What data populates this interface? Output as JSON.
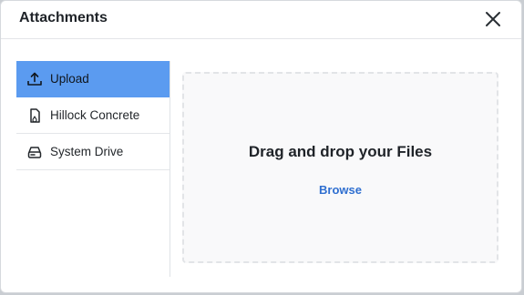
{
  "dialog": {
    "title": "Attachments",
    "close_icon": "close-icon"
  },
  "sidebar": {
    "items": [
      {
        "label": "Upload",
        "icon": "upload-icon",
        "active": true
      },
      {
        "label": "Hillock Concrete",
        "icon": "document-icon",
        "active": false
      },
      {
        "label": "System Drive",
        "icon": "drive-icon",
        "active": false
      }
    ]
  },
  "dropzone": {
    "title": "Drag and drop your Files",
    "browse_label": "Browse"
  },
  "colors": {
    "accent": "#5b9bf0",
    "link": "#2f6fd0"
  }
}
